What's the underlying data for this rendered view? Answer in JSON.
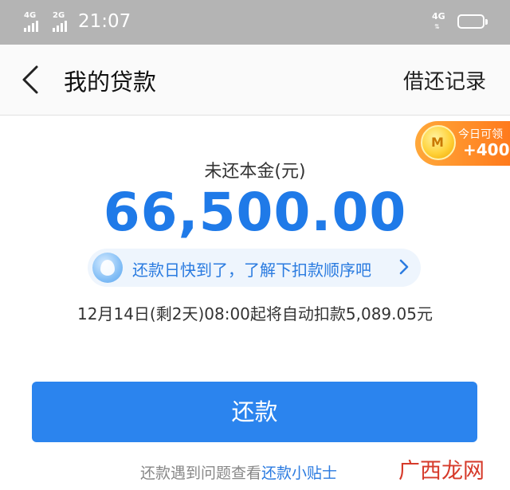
{
  "status_bar": {
    "network_1": "4G",
    "network_2": "2G",
    "time": "21:07",
    "network_right": "4G",
    "icons": [
      "signal-icon",
      "signal-icon",
      "battery-icon"
    ]
  },
  "header": {
    "title": "我的贷款",
    "right_link": "借还记录",
    "back_icon": "chevron-left-icon"
  },
  "reward": {
    "label": "今日可领",
    "amount": "+400",
    "icon": "coin-icon"
  },
  "loan": {
    "principal_label": "未还本金(元)",
    "principal_value": "66,500.00"
  },
  "notice": {
    "text": "还款日快到了，了解下扣款顺序吧",
    "icon": "bubble-icon",
    "arrow_icon": "chevron-right-icon"
  },
  "deduction_info": "12月14日(剩2天)08:00起将自动扣款5,089.05元",
  "repay_button": "还款",
  "tips": {
    "prefix": "还款遇到问题查看",
    "link": "还款小贴士"
  },
  "watermark": "广西龙网",
  "colors": {
    "accent": "#2b84ee",
    "principal": "#1f7ae8",
    "reward": "#ff8a26",
    "status_bar": "#b4b4b4"
  }
}
